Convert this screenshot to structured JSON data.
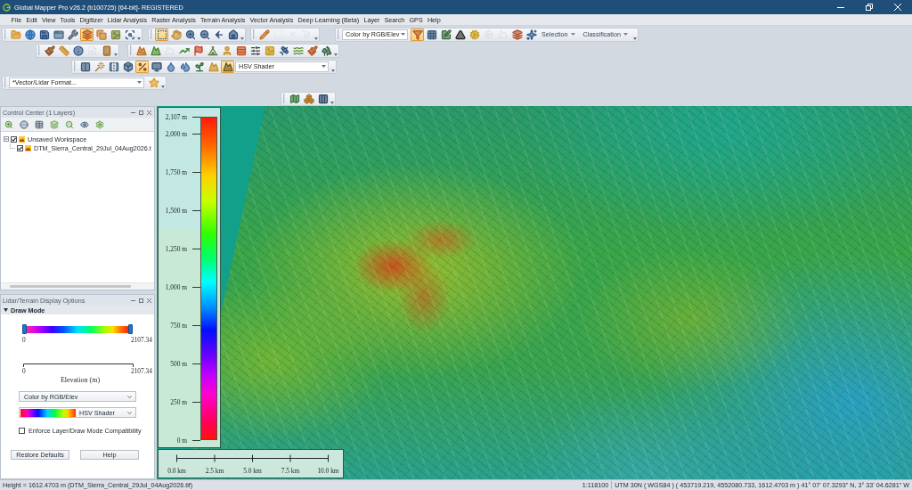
{
  "window": {
    "title": "Global Mapper Pro v26.2 (b100725) [64-bit]- REGISTERED"
  },
  "menu": [
    "File",
    "Edit",
    "View",
    "Tools",
    "Digitizer",
    "Lidar Analysis",
    "Raster Analysis",
    "Terrain Analysis",
    "Vector Analysis",
    "Deep Learning (Beta)",
    "Layer",
    "Search",
    "GPS",
    "Help"
  ],
  "toolbar_rows": [
    {
      "toolbars": [
        {
          "items": [
            {
              "kind": "button",
              "selected": false,
              "disabled": false
            },
            {
              "kind": "button",
              "selected": false,
              "disabled": false
            },
            {
              "kind": "button",
              "selected": false,
              "disabled": false
            },
            {
              "kind": "button",
              "selected": false,
              "disabled": false
            },
            {
              "kind": "button",
              "selected": false,
              "disabled": false
            },
            {
              "kind": "button",
              "selected": true,
              "disabled": false
            },
            {
              "kind": "button",
              "selected": false,
              "disabled": false
            },
            {
              "kind": "button",
              "selected": false,
              "disabled": false
            },
            {
              "kind": "button",
              "selected": false,
              "disabled": false
            }
          ]
        },
        {
          "items": [
            {
              "kind": "button",
              "selected": true,
              "disabled": false
            },
            {
              "kind": "button",
              "selected": false,
              "disabled": false
            },
            {
              "kind": "button",
              "selected": false,
              "disabled": false
            },
            {
              "kind": "button",
              "selected": false,
              "disabled": false
            },
            {
              "kind": "button",
              "selected": false,
              "disabled": false
            },
            {
              "kind": "button",
              "selected": false,
              "disabled": false
            }
          ]
        },
        {
          "items": [
            {
              "kind": "button",
              "selected": false,
              "disabled": false
            },
            {
              "kind": "button",
              "selected": false,
              "disabled": true
            },
            {
              "kind": "button",
              "selected": false,
              "disabled": true
            },
            {
              "kind": "button",
              "selected": false,
              "disabled": true
            }
          ]
        },
        {
          "items": [
            {
              "kind": "dropdown",
              "value": "Color by RGB/Elev"
            },
            {
              "kind": "button",
              "selected": true,
              "disabled": false
            },
            {
              "kind": "button",
              "selected": false,
              "disabled": false
            },
            {
              "kind": "button",
              "selected": false,
              "disabled": false
            },
            {
              "kind": "button",
              "selected": false,
              "disabled": false
            },
            {
              "kind": "button",
              "selected": false,
              "disabled": false
            },
            {
              "kind": "button",
              "selected": false,
              "disabled": true
            },
            {
              "kind": "button",
              "selected": false,
              "disabled": true
            },
            {
              "kind": "button",
              "selected": false,
              "disabled": false
            },
            {
              "kind": "button",
              "selected": false,
              "disabled": false
            },
            {
              "kind": "menu",
              "label": "Selection"
            },
            {
              "kind": "menu",
              "label": "Classification"
            }
          ]
        }
      ]
    },
    {
      "toolbars": [
        {
          "items": [
            {
              "kind": "button",
              "selected": false,
              "disabled": false
            },
            {
              "kind": "button",
              "selected": false,
              "disabled": false
            },
            {
              "kind": "button",
              "selected": false,
              "disabled": false
            },
            {
              "kind": "button",
              "selected": false,
              "disabled": true
            },
            {
              "kind": "button",
              "selected": false,
              "disabled": false
            }
          ]
        },
        {
          "items": [
            {
              "kind": "button",
              "selected": false,
              "disabled": false
            },
            {
              "kind": "button",
              "selected": false,
              "disabled": false
            },
            {
              "kind": "button",
              "selected": false,
              "disabled": true
            },
            {
              "kind": "button",
              "selected": false,
              "disabled": false
            },
            {
              "kind": "button",
              "selected": false,
              "disabled": false
            },
            {
              "kind": "button",
              "selected": false,
              "disabled": false
            },
            {
              "kind": "button",
              "selected": false,
              "disabled": false
            },
            {
              "kind": "button",
              "selected": false,
              "disabled": false
            },
            {
              "kind": "button",
              "selected": false,
              "disabled": false
            },
            {
              "kind": "button",
              "selected": false,
              "disabled": false
            },
            {
              "kind": "button",
              "selected": false,
              "disabled": false
            },
            {
              "kind": "button",
              "selected": false,
              "disabled": false
            },
            {
              "kind": "button",
              "selected": false,
              "disabled": false
            },
            {
              "kind": "button",
              "selected": false,
              "disabled": false
            }
          ]
        }
      ]
    },
    {
      "toolbars": [
        {
          "items": [
            {
              "kind": "button",
              "selected": false,
              "disabled": false
            },
            {
              "kind": "button",
              "selected": false,
              "disabled": false
            },
            {
              "kind": "button",
              "selected": false,
              "disabled": false
            },
            {
              "kind": "button",
              "selected": false,
              "disabled": false
            },
            {
              "kind": "button",
              "selected": true,
              "disabled": false
            },
            {
              "kind": "button",
              "selected": false,
              "disabled": false
            },
            {
              "kind": "button",
              "selected": false,
              "disabled": false
            },
            {
              "kind": "button",
              "selected": false,
              "disabled": false
            },
            {
              "kind": "button",
              "selected": false,
              "disabled": false
            },
            {
              "kind": "button",
              "selected": false,
              "disabled": false
            },
            {
              "kind": "button",
              "selected": true,
              "disabled": false
            },
            {
              "kind": "dropdown",
              "value": "HSV Shader"
            }
          ]
        }
      ]
    },
    {
      "toolbars": [
        {
          "items": [
            {
              "kind": "dropdown",
              "value": "*Vector/Lidar Format..."
            },
            {
              "kind": "button",
              "selected": false,
              "disabled": false
            }
          ]
        }
      ]
    },
    {
      "toolbars": [
        {
          "items": [
            {
              "kind": "button",
              "selected": false,
              "disabled": false
            },
            {
              "kind": "button",
              "selected": false,
              "disabled": false
            },
            {
              "kind": "button",
              "selected": false,
              "disabled": false
            }
          ]
        }
      ]
    }
  ],
  "control_center": {
    "title": "Control Center (1 Layers)",
    "tree": [
      {
        "label": "Unsaved Workspace",
        "checked": true,
        "expanded": true,
        "children": [
          {
            "label": "DTM_Sierra_Central_29Jul_04Aug2026.t",
            "checked": true
          }
        ]
      }
    ]
  },
  "display_options": {
    "title": "Lidar/Terrain Display Options",
    "section": {
      "label": "Draw Mode",
      "expanded": true
    },
    "range": {
      "min_label": "0",
      "max_label": "2107.34",
      "low_handle": {
        "level": 0
      },
      "high_handle": {
        "level": 1
      }
    },
    "axis": {
      "min_label": "0",
      "max_label": "2107.34",
      "title": "Elevation (m)"
    },
    "color_mode": {
      "value": "Color by RGB/Elev"
    },
    "shader": {
      "value": "HSV Shader"
    },
    "enforce_compatibility": {
      "label": "Enforce Layer/Draw Mode Compatibility",
      "checked": false
    },
    "buttons": [
      "Restore Defaults",
      "Help"
    ]
  },
  "map": {
    "legend": {
      "labels": [
        "2,107 m",
        "2,000 m",
        "1,750 m",
        "1,500 m",
        "1,250 m",
        "1,000 m",
        "750 m",
        "500 m",
        "250 m",
        "0 m"
      ]
    },
    "scale_bar": {
      "labels": [
        "0.0 km",
        "2.5 km",
        "5.0 km",
        "7.5 km",
        "10.0 km"
      ]
    }
  },
  "status_bar": {
    "message": "Height = 1612.4703 m (DTM_Sierra_Central_29Jul_04Aug2026.tif)",
    "scale": "1:118100",
    "coordinates": "UTM 30N ( WGS84 ) ( 453719.219, 4552080.733, 1612.4703 m ) 41° 07' 07.3293\" N, 3° 33' 04.6281\" W"
  }
}
